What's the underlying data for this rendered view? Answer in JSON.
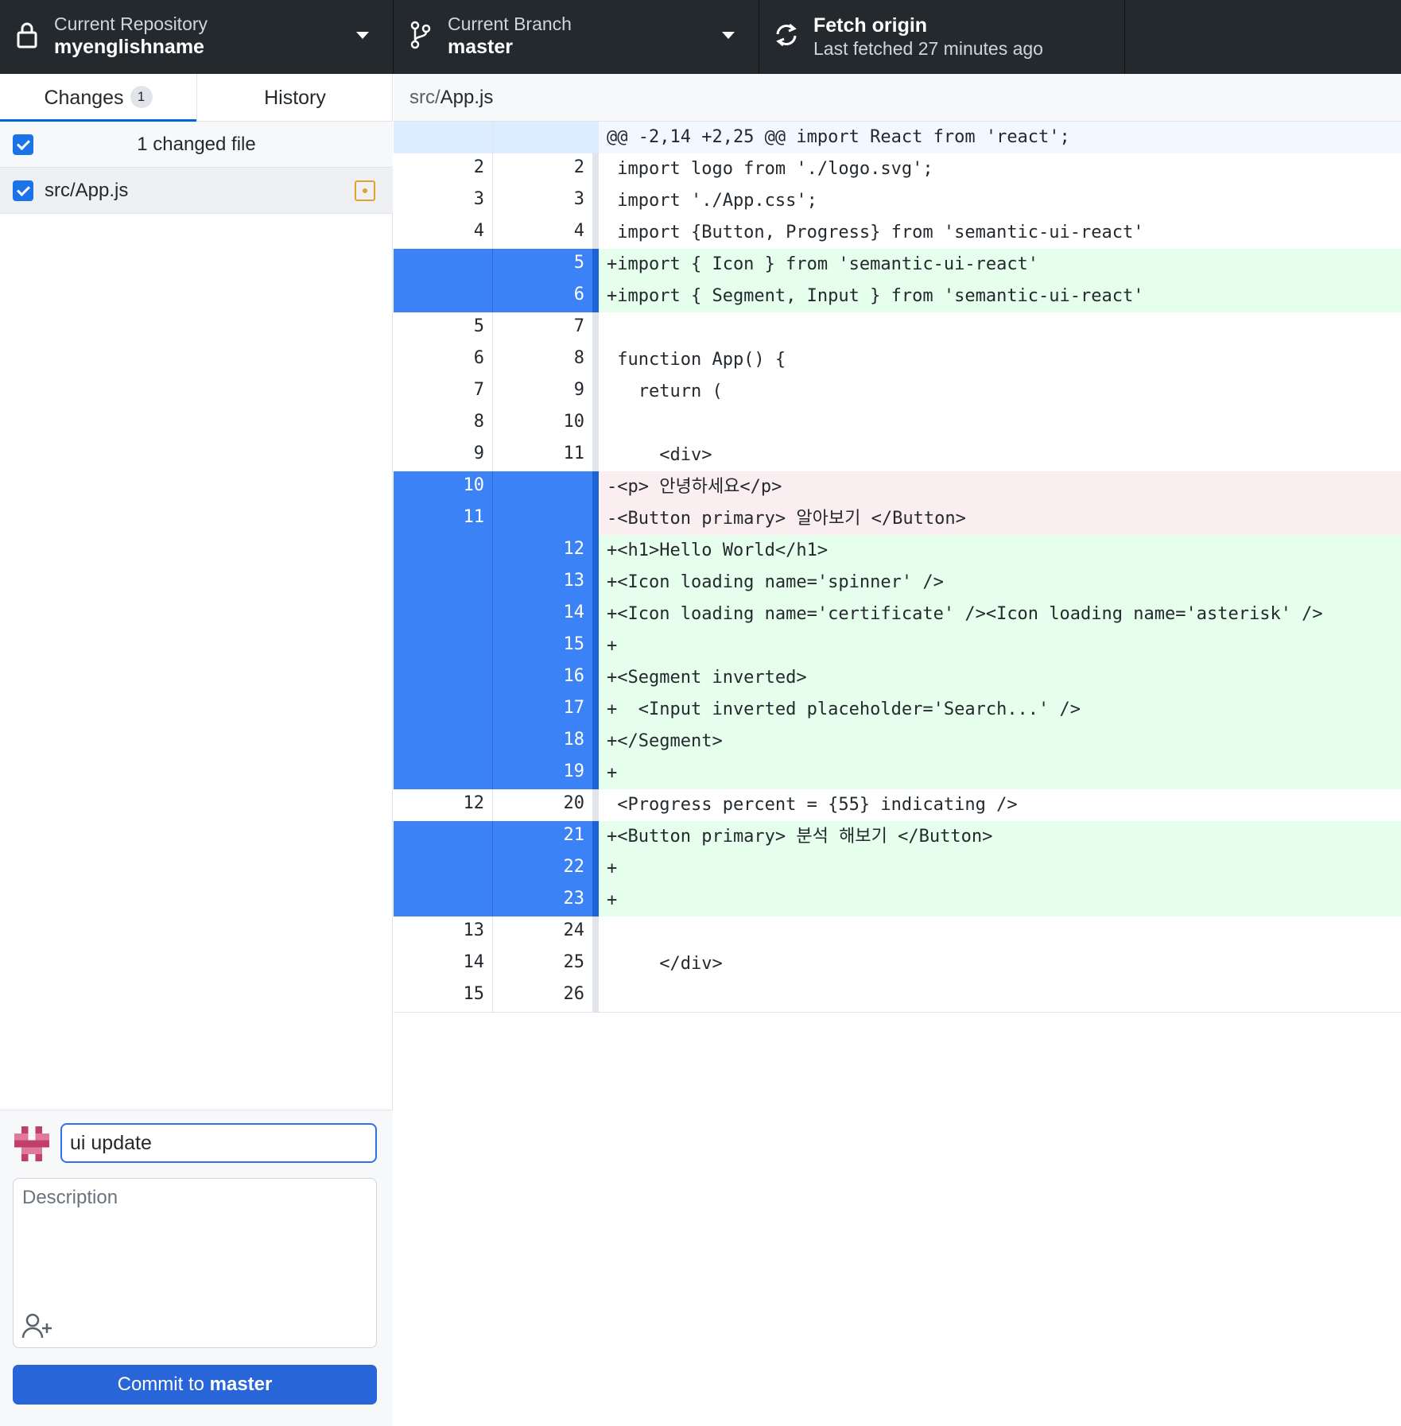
{
  "toolbar": {
    "repository": {
      "title": "Current Repository",
      "value": "myenglishname"
    },
    "branch": {
      "title": "Current Branch",
      "value": "master"
    },
    "fetch": {
      "title": "Fetch origin",
      "subtitle": "Last fetched 27 minutes ago"
    }
  },
  "sidebar": {
    "tabs": [
      {
        "label": "Changes",
        "badge": "1"
      },
      {
        "label": "History"
      }
    ],
    "changed_count": "1 changed file",
    "files": [
      {
        "path": "src/App.js",
        "checked": true
      }
    ],
    "commit": {
      "summary_value": "ui update",
      "description_placeholder": "Description",
      "button_prefix": "Commit to ",
      "button_branch": "master"
    }
  },
  "diff": {
    "path_dir": "src/",
    "path_file": "App.js",
    "lines": [
      {
        "type": "hunk",
        "old": "",
        "new": "",
        "text": "@@ -2,14 +2,25 @@ import React from 'react';"
      },
      {
        "type": "ctx",
        "old": "2",
        "new": "2",
        "text": " import logo from './logo.svg';"
      },
      {
        "type": "ctx",
        "old": "3",
        "new": "3",
        "text": " import './App.css';"
      },
      {
        "type": "ctx",
        "old": "4",
        "new": "4",
        "text": " import {Button, Progress} from 'semantic-ui-react'"
      },
      {
        "type": "add",
        "old": "",
        "new": "5",
        "text": "+import { Icon } from 'semantic-ui-react'"
      },
      {
        "type": "add",
        "old": "",
        "new": "6",
        "text": "+import { Segment, Input } from 'semantic-ui-react'"
      },
      {
        "type": "ctx",
        "old": "5",
        "new": "7",
        "text": ""
      },
      {
        "type": "ctx",
        "old": "6",
        "new": "8",
        "text": " function App() {"
      },
      {
        "type": "ctx",
        "old": "7",
        "new": "9",
        "text": "   return ("
      },
      {
        "type": "ctx",
        "old": "8",
        "new": "10",
        "text": ""
      },
      {
        "type": "ctx",
        "old": "9",
        "new": "11",
        "text": "     <div>"
      },
      {
        "type": "del",
        "old": "10",
        "new": "",
        "text": "-<p> 안녕하세요</p>"
      },
      {
        "type": "del",
        "old": "11",
        "new": "",
        "text": "-<Button primary> 알아보기 </Button>"
      },
      {
        "type": "add",
        "old": "",
        "new": "12",
        "text": "+<h1>Hello World</h1>"
      },
      {
        "type": "add",
        "old": "",
        "new": "13",
        "text": "+<Icon loading name='spinner' />"
      },
      {
        "type": "add",
        "old": "",
        "new": "14",
        "text": "+<Icon loading name='certificate' /><Icon loading name='asterisk' />"
      },
      {
        "type": "add",
        "old": "",
        "new": "15",
        "text": "+"
      },
      {
        "type": "add",
        "old": "",
        "new": "16",
        "text": "+<Segment inverted>"
      },
      {
        "type": "add",
        "old": "",
        "new": "17",
        "text": "+  <Input inverted placeholder='Search...' />"
      },
      {
        "type": "add",
        "old": "",
        "new": "18",
        "text": "+</Segment>"
      },
      {
        "type": "add",
        "old": "",
        "new": "19",
        "text": "+"
      },
      {
        "type": "ctx",
        "old": "12",
        "new": "20",
        "text": " <Progress percent = {55} indicating />"
      },
      {
        "type": "add",
        "old": "",
        "new": "21",
        "text": "+<Button primary> 분석 해보기 </Button>"
      },
      {
        "type": "add",
        "old": "",
        "new": "22",
        "text": "+"
      },
      {
        "type": "add",
        "old": "",
        "new": "23",
        "text": "+"
      },
      {
        "type": "ctx",
        "old": "13",
        "new": "24",
        "text": ""
      },
      {
        "type": "ctx",
        "old": "14",
        "new": "25",
        "text": "     </div>"
      },
      {
        "type": "ctx",
        "old": "15",
        "new": "26",
        "text": ""
      }
    ]
  },
  "colors": {
    "toolbar_bg": "#24292e",
    "accent": "#2765d8",
    "added_bg": "#e6ffed",
    "deleted_bg": "#fbeef0",
    "selected_gutter": "#3b82f6",
    "modified": "#e3a22b"
  },
  "icons": {
    "repository": "lock-icon",
    "branch": "git-branch-icon",
    "fetch": "sync-icon",
    "modified": "file-modified-icon",
    "coauthor": "add-person-icon"
  }
}
